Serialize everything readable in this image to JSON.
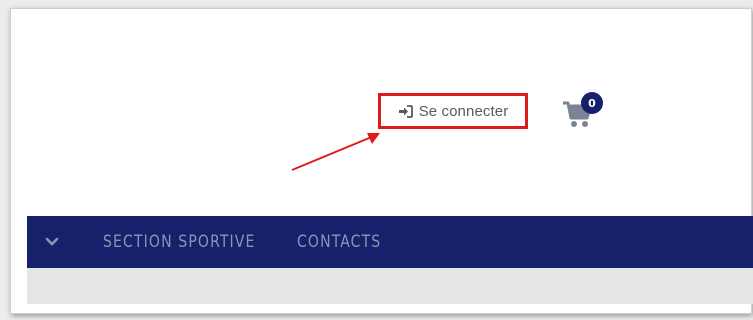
{
  "header": {
    "login_label": "Se connecter",
    "login_icon": "sign-in-icon",
    "cart_icon": "shopping-cart-icon",
    "cart_count": "0"
  },
  "navbar": {
    "toggle_icon": "chevron-down-icon",
    "items": [
      {
        "label": "SECTION SPORTIVE"
      },
      {
        "label": "CONTACTS"
      }
    ]
  },
  "colors": {
    "navbar_bg": "#16206b",
    "nav_text": "#8e93b6",
    "highlight_border": "#e01a1a",
    "cart_icon": "#7a8494",
    "badge_bg": "#16206b"
  }
}
